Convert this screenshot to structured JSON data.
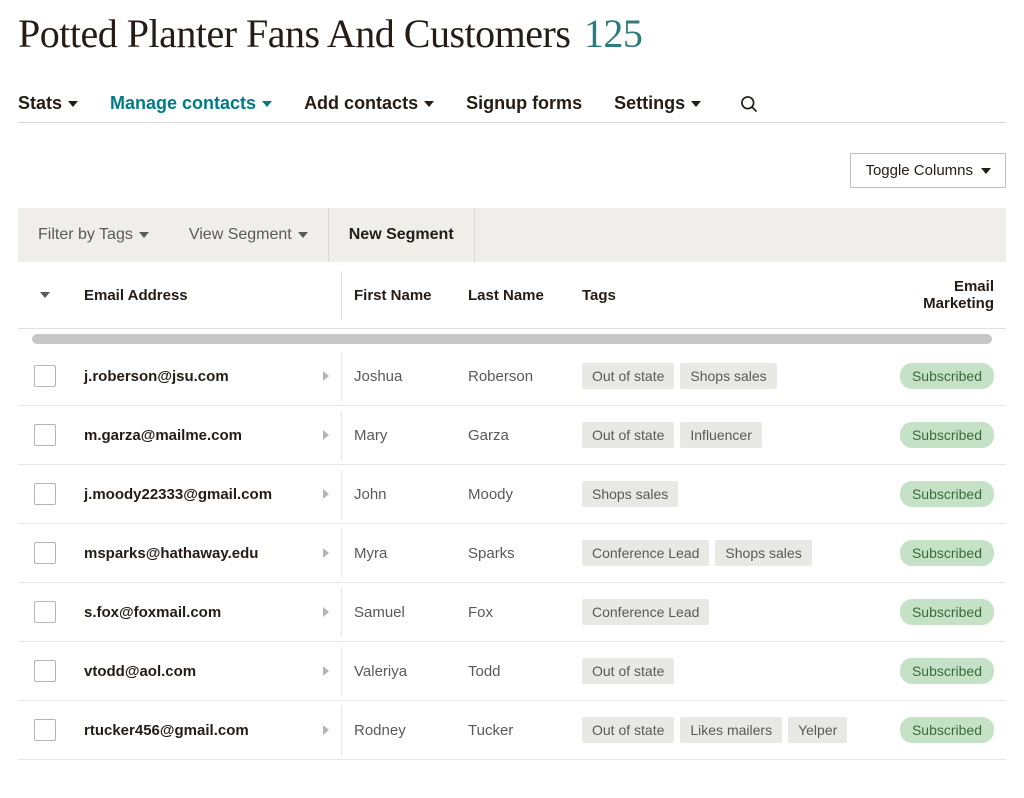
{
  "header": {
    "title": "Potted Planter Fans And Customers",
    "count": "125"
  },
  "nav": {
    "stats": "Stats",
    "manage_contacts": "Manage contacts",
    "add_contacts": "Add contacts",
    "signup_forms": "Signup forms",
    "settings": "Settings"
  },
  "toolbar": {
    "toggle_columns": "Toggle Columns"
  },
  "segment_bar": {
    "filter_by_tags": "Filter by Tags",
    "view_segment": "View Segment",
    "new_segment": "New Segment"
  },
  "columns": {
    "email": "Email Address",
    "first_name": "First Name",
    "last_name": "Last Name",
    "tags": "Tags",
    "email_marketing": "Email Marketing"
  },
  "status_labels": {
    "subscribed": "Subscribed"
  },
  "contacts": [
    {
      "email": "j.roberson@jsu.com",
      "first_name": "Joshua",
      "last_name": "Roberson",
      "tags": [
        "Out of state",
        "Shops sales"
      ],
      "status": "subscribed"
    },
    {
      "email": "m.garza@mailme.com",
      "first_name": "Mary",
      "last_name": "Garza",
      "tags": [
        "Out of state",
        "Influencer"
      ],
      "status": "subscribed"
    },
    {
      "email": "j.moody22333@gmail.com",
      "first_name": "John",
      "last_name": "Moody",
      "tags": [
        "Shops sales"
      ],
      "status": "subscribed"
    },
    {
      "email": "msparks@hathaway.edu",
      "first_name": "Myra",
      "last_name": "Sparks",
      "tags": [
        "Conference Lead",
        "Shops sales"
      ],
      "status": "subscribed"
    },
    {
      "email": "s.fox@foxmail.com",
      "first_name": "Samuel",
      "last_name": "Fox",
      "tags": [
        "Conference Lead"
      ],
      "status": "subscribed"
    },
    {
      "email": "vtodd@aol.com",
      "first_name": "Valeriya",
      "last_name": "Todd",
      "tags": [
        "Out of state"
      ],
      "status": "subscribed"
    },
    {
      "email": "rtucker456@gmail.com",
      "first_name": "Rodney",
      "last_name": "Tucker",
      "tags": [
        "Out of state",
        "Likes mailers",
        "Yelper"
      ],
      "status": "subscribed"
    }
  ]
}
